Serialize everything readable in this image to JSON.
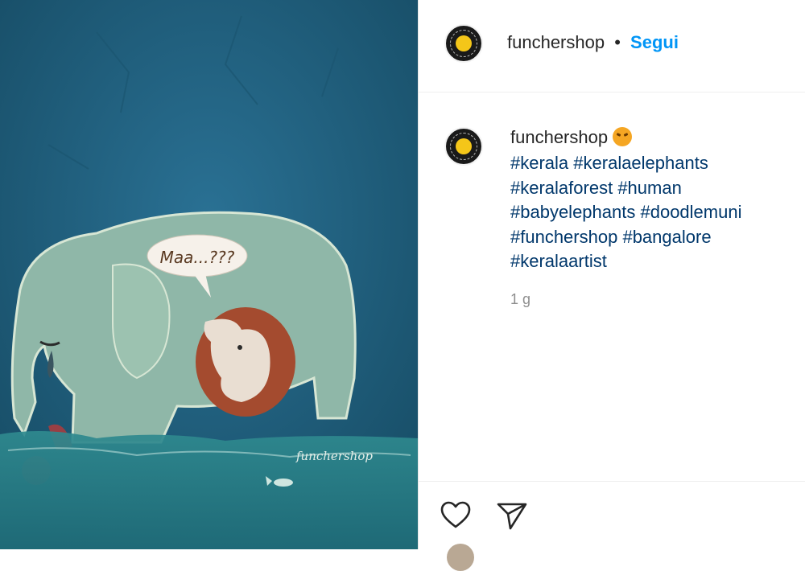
{
  "post": {
    "image": {
      "speech_bubble": "Maa...???",
      "signature": "funchershop"
    }
  },
  "header": {
    "username": "funchershop",
    "separator": "•",
    "follow_label": "Segui"
  },
  "caption": {
    "username": "funchershop",
    "emoji": "angry-face-emoji",
    "hashtags": [
      "#kerala",
      "#keralaelephants",
      "#keralaforest",
      "#human",
      "#babyelephants",
      "#doodlemuni",
      "#funchershop",
      "#bangalore",
      "#keralaartist"
    ],
    "timestamp": "1 g"
  },
  "actions": {
    "like_icon": "heart-icon",
    "share_icon": "paper-plane-icon"
  },
  "colors": {
    "link_blue": "#0095f6",
    "hashtag_blue": "#00376b",
    "meta_gray": "#8e8e8e"
  }
}
